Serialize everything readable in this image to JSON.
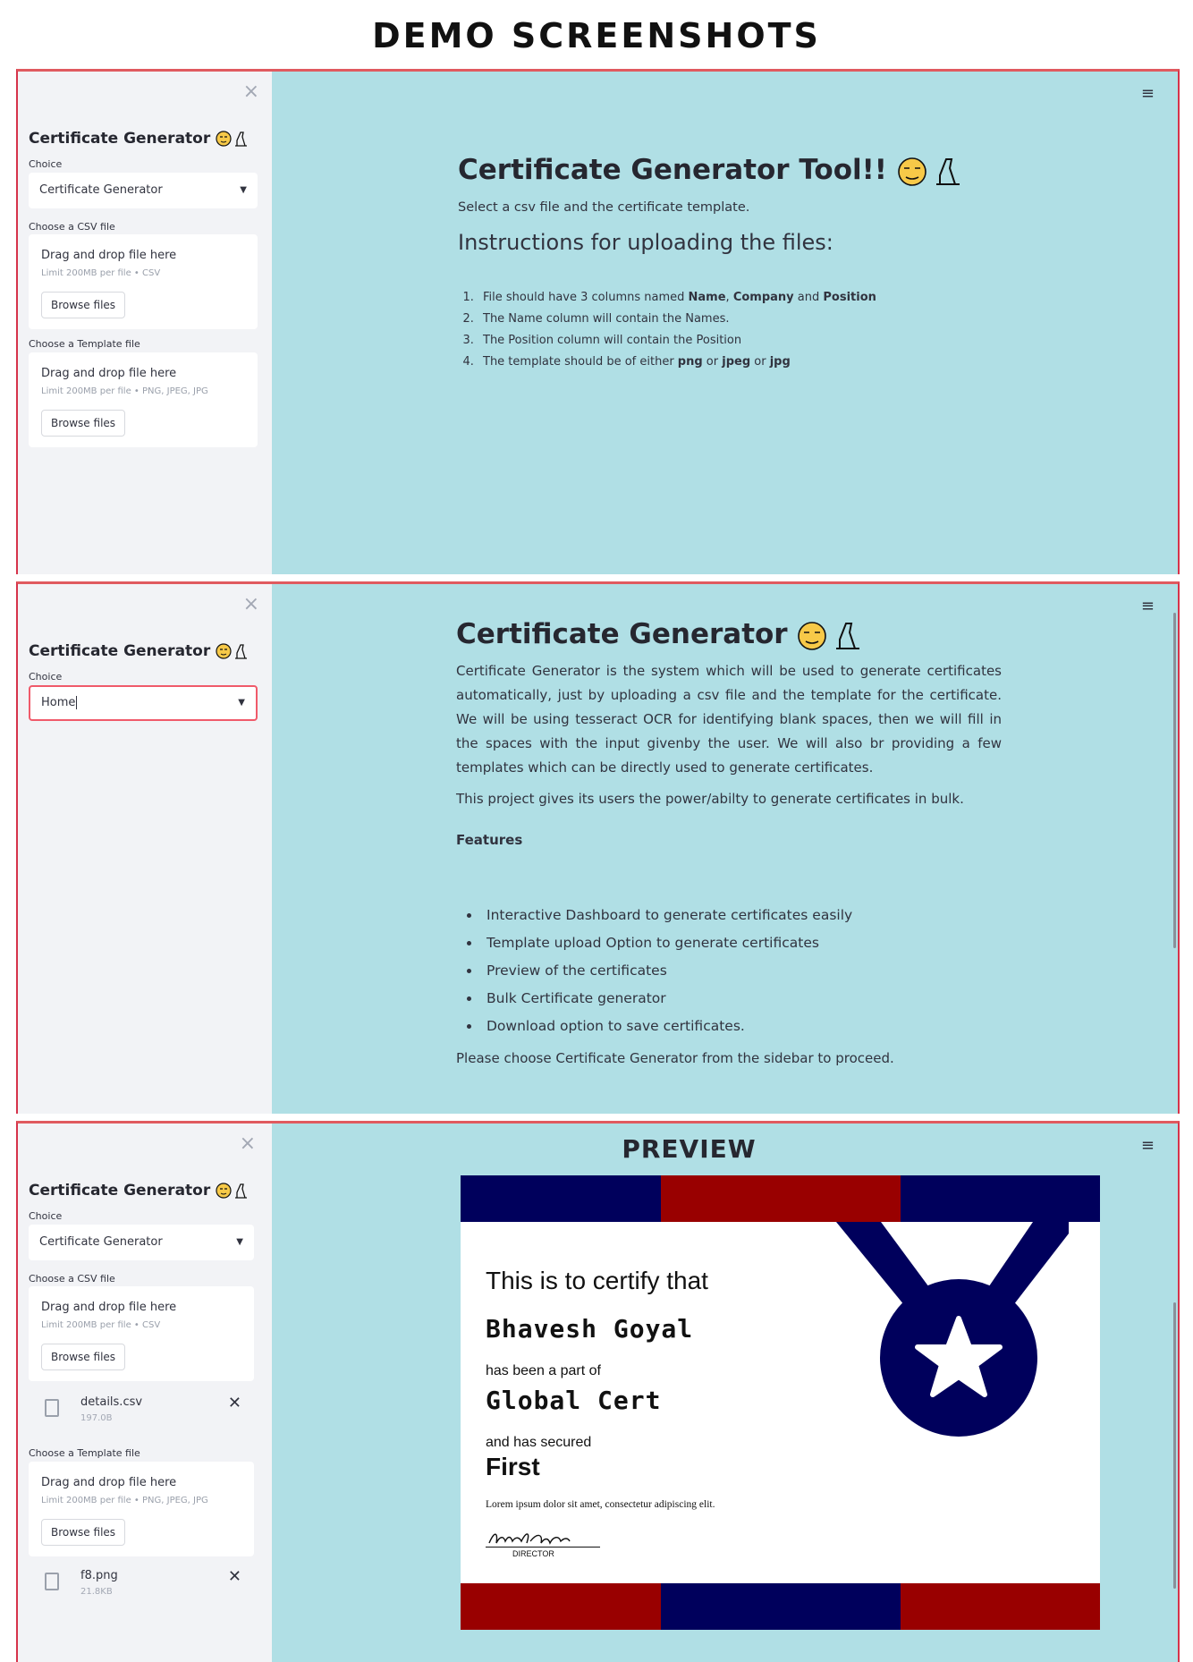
{
  "heading": "DEMO SCREENSHOTS",
  "sidebar": {
    "close": "×",
    "title": "Certificate Generator",
    "choice_label": "Choice",
    "csv_label": "Choose a CSV file",
    "template_label": "Choose a Template file",
    "drag_drop": "Drag and drop file here",
    "csv_limit": "Limit 200MB per file • CSV",
    "template_limit": "Limit 200MB per file • PNG, JPEG, JPG",
    "browse": "Browse files"
  },
  "menu_icon": "≡",
  "panel1": {
    "select_value": "Certificate Generator",
    "title": "Certificate Generator Tool!!",
    "subtitle": "Select a csv file and the certificate template.",
    "instructions_heading": "Instructions for uploading the files:",
    "instructions": [
      {
        "pre": "File should have 3 columns named ",
        "b1": "Name",
        "m1": ", ",
        "b2": "Company",
        "m2": " and ",
        "b3": "Position"
      },
      {
        "text": "The Name column will contain the Names."
      },
      {
        "text": "The Position column will contain the Position"
      },
      {
        "pre": "The template should be of either ",
        "b1": "png",
        "m1": " or ",
        "b2": "jpeg",
        "m2": " or ",
        "b3": "jpg"
      }
    ]
  },
  "panel2": {
    "select_value": "Home",
    "title": "Certificate Generator",
    "paragraph": "Certificate Generator is the system which will be used to generate certificates automatically, just by uploading a csv file and the template for the certificate. We will be using tesseract OCR for identifying blank spaces, then we will fill in the spaces with the input givenby the user. We will also br providing a few templates which can be directly used to generate certificates.",
    "bulk": "This project gives its users the power/abilty to generate certificates in bulk.",
    "features_heading": "Features",
    "features": [
      "Interactive Dashboard to generate certificates easily",
      "Template upload Option to generate certificates",
      "Preview of the certificates",
      "Bulk Certificate generator",
      "Download option to save certificates."
    ],
    "proceed": "Please choose Certificate Generator from the sidebar to proceed."
  },
  "panel3": {
    "select_value": "Certificate Generator",
    "csv_file": {
      "name": "details.csv",
      "size": "197.0B"
    },
    "template_file": {
      "name": "f8.png",
      "size": "21.8KB"
    },
    "preview_title": "PREVIEW",
    "certificate": {
      "line1": "This is to certify that",
      "name": "Bhavesh Goyal",
      "line2": "has been a part of",
      "company": "Global Cert",
      "line3": "and has secured",
      "position": "First",
      "lorem": "Lorem ipsum dolor sit amet, consectetur adipiscing elit.",
      "signature": "Bhavesh Goyal",
      "role": "DIRECTOR"
    }
  },
  "colors": {
    "accent": "#f05a6a",
    "main_bg": "#b0dfe5",
    "sidebar_bg": "#f2f3f6",
    "navy": "#00005c",
    "crimson": "#990000"
  }
}
